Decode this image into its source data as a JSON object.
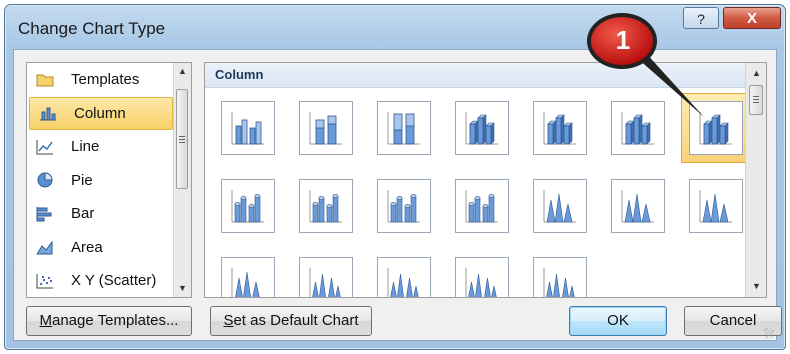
{
  "window": {
    "title": "Change Chart Type",
    "help_label": "?",
    "close_label": "X"
  },
  "categories": [
    {
      "label": "Templates",
      "icon": "folder-icon"
    },
    {
      "label": "Column",
      "icon": "column-chart-icon",
      "selected": true
    },
    {
      "label": "Line",
      "icon": "line-chart-icon"
    },
    {
      "label": "Pie",
      "icon": "pie-chart-icon"
    },
    {
      "label": "Bar",
      "icon": "bar-chart-icon"
    },
    {
      "label": "Area",
      "icon": "area-chart-icon"
    },
    {
      "label": "X Y (Scatter)",
      "icon": "scatter-chart-icon"
    }
  ],
  "gallery": {
    "group_title": "Column",
    "selected_index": 6
  },
  "buttons": {
    "manage_templates": {
      "u": "M",
      "rest": "anage Templates..."
    },
    "set_default": {
      "u": "S",
      "rest": "et as Default Chart"
    },
    "ok": "OK",
    "cancel": "Cancel"
  },
  "callout": {
    "number": "1",
    "color": "#d42424"
  },
  "colors": {
    "selection": "#f8d06a",
    "accent": "#3c7fb1"
  }
}
